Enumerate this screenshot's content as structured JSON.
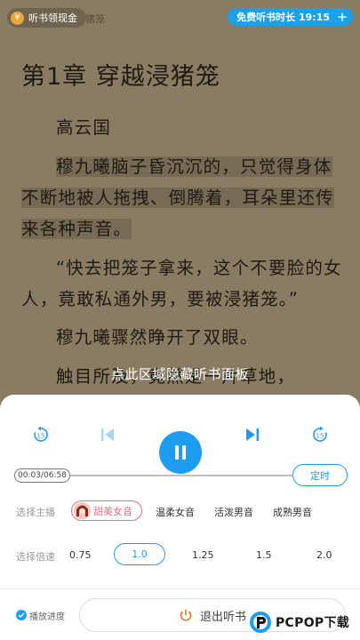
{
  "header": {
    "reward_label": "听书领现金",
    "faded_title": "猪笼",
    "free_listen_label": "免费听书时长 19:15",
    "plus_symbol": "+"
  },
  "reader": {
    "chapter_title": "第1章  穿越浸猪笼",
    "paragraphs": [
      "高云国",
      "穆九曦脑子昏沉沉的，只觉得身体不断地被人拖拽、倒腾着，耳朵里还传来各种声音。",
      "“快去把笼子拿来，这个不要脸的女人，竟敢私通外男，要被浸猪笼。”",
      "穆九曦骤然睁开了双眼。",
      "触目所及，竟然是一片草地，"
    ],
    "overlay_tip": "点此区域隐藏听书面板"
  },
  "player": {
    "rewind_label": "15",
    "forward_label": "15",
    "time_display": "00:03/06:58",
    "progress_fraction": 0.0072,
    "timer_label": "定时",
    "accent_color": "#1e9cf0"
  },
  "voice": {
    "row_label": "选择主播",
    "selected": "甜美女音",
    "options": [
      "温柔女音",
      "活泼男音",
      "成熟男音"
    ]
  },
  "speed": {
    "row_label": "选择倍速",
    "options": [
      "0.75",
      "1.0",
      "1.25",
      "1.5",
      "2.0"
    ],
    "selected": "1.0"
  },
  "footer": {
    "progress_label": "播放进度",
    "exit_label": "退出听书",
    "watermark": "PCPOP下载"
  }
}
